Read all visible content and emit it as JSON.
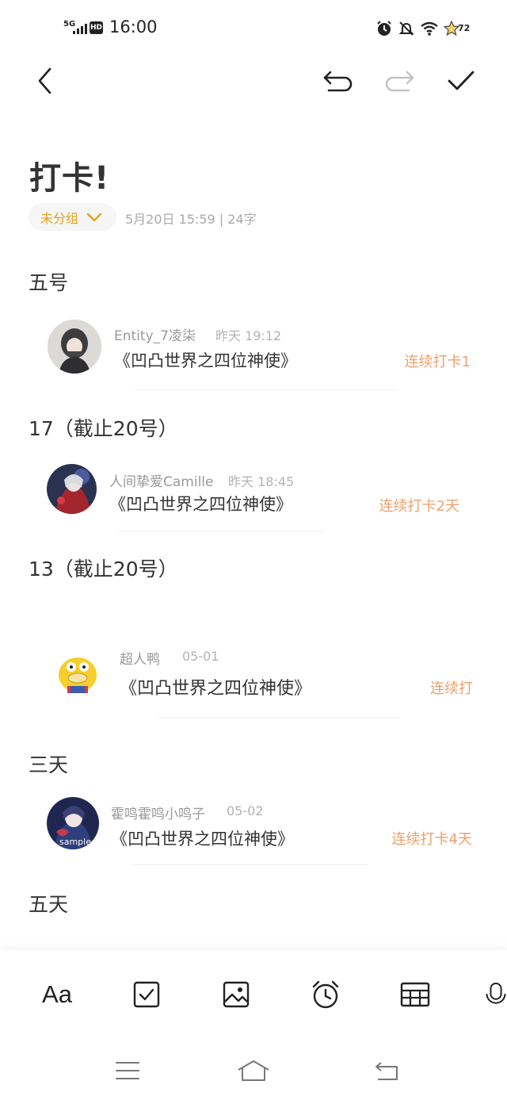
{
  "status_bar": {
    "network": "5G",
    "hd": "HD",
    "time": "16:00",
    "battery": "72"
  },
  "toolbar": {
    "back": "back-icon",
    "undo": "undo-icon",
    "redo": "redo-icon",
    "done": "check-icon"
  },
  "note": {
    "title": "打卡!",
    "folder": "未分组",
    "meta": "5月20日 15:59  |  24字"
  },
  "sections": [
    {
      "heading": "五号",
      "entry": {
        "name": "Entity_7凌柒",
        "time": "昨天 19:12",
        "book": "《凹凸世界之四位神使》",
        "streak": "连续打卡1"
      }
    },
    {
      "heading": "17（截止20号）",
      "entry": {
        "name": "人间挚爱Camille",
        "time": "昨天 18:45",
        "book": "《凹凸世界之四位神使》",
        "streak": "连续打卡2天"
      }
    },
    {
      "heading": "13（截止20号）",
      "entry": {
        "name": "超人鸭",
        "time": "05-01",
        "book": "《凹凸世界之四位神使》",
        "streak": "连续打"
      }
    },
    {
      "heading": "三天",
      "entry": {
        "name": "霍鸣霍鸣小鸣子",
        "time": "05-02",
        "book": "《凹凸世界之四位神使》",
        "streak": "连续打卡4天"
      }
    },
    {
      "heading": "五天"
    }
  ],
  "bottom_tools": {
    "font": "Aa",
    "checklist": "checkbox-icon",
    "image": "image-icon",
    "alarm": "alarm-icon",
    "table": "table-icon",
    "voice": "microphone-icon"
  },
  "nav": {
    "menu": "menu-icon",
    "home": "home-icon",
    "back": "back-nav-icon"
  },
  "colors": {
    "accent": "#e4a21c",
    "streak": "#eda16c",
    "text": "#333333",
    "muted": "#9a9a9a"
  }
}
